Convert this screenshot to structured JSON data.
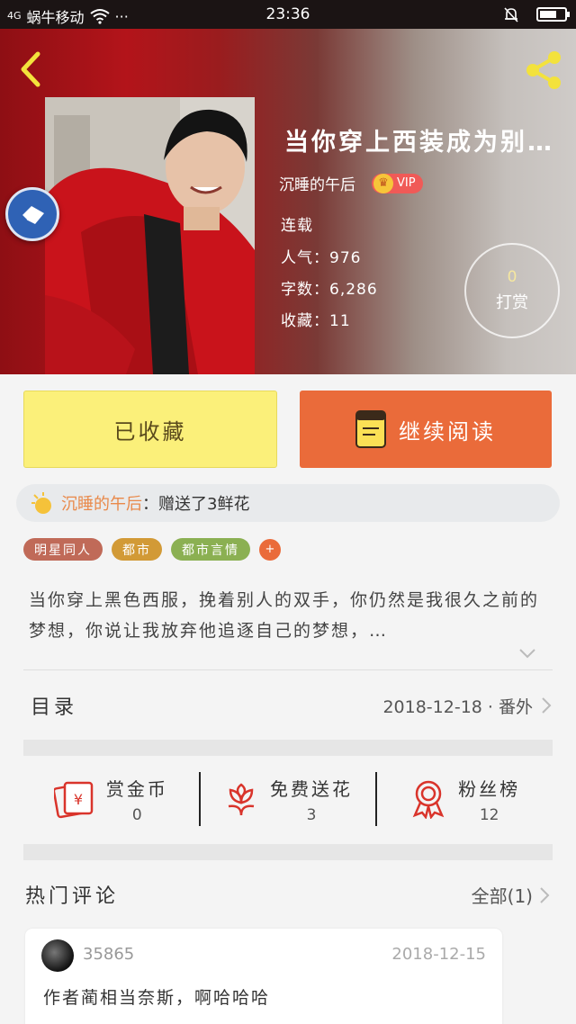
{
  "status_bar": {
    "network": "4G",
    "carrier": "蜗牛移动",
    "more": "···",
    "time": "23:36",
    "battery_level": 0.7
  },
  "book": {
    "title": "当你穿上西装成为别…",
    "author": "沉睡的午后",
    "vip_label": "VIP",
    "status": "连载",
    "popularity_label": "人气：976",
    "word_count_label": "字数：6,286",
    "favorites_label": "收藏：11"
  },
  "tip": {
    "count": "0",
    "label": "打赏"
  },
  "actions": {
    "collected_label": "已收藏",
    "continue_label": "继续阅读"
  },
  "gift": {
    "user": "沉睡的午后",
    "text": "：赠送了3鲜花"
  },
  "tags": [
    {
      "label": "明星同人",
      "color": "#c06a58"
    },
    {
      "label": "都市",
      "color": "#d29a36"
    },
    {
      "label": "都市言情",
      "color": "#8bb052"
    }
  ],
  "tag_more": "+",
  "description": "当你穿上黑色西服，挽着别人的双手，你仍然是我很久之前的梦想，你说让我放弃他追逐自己的梦想，…",
  "toc": {
    "label": "目录",
    "latest": "2018-12-18 · 番外"
  },
  "stats": [
    {
      "label": "赏金币",
      "value": "0",
      "icon": "red-envelope-icon"
    },
    {
      "label": "免费送花",
      "value": "3",
      "icon": "flower-icon"
    },
    {
      "label": "粉丝榜",
      "value": "12",
      "icon": "medal-icon"
    }
  ],
  "hot_comments": {
    "title": "热门评论",
    "all_label": "全部(1)",
    "items": [
      {
        "user": "35865",
        "date": "2018-12-15",
        "text": "作者蔺相当奈斯，啊哈哈哈"
      }
    ]
  },
  "colors": {
    "accent": "#ea6b3a",
    "collect": "#fbf07a",
    "stat_icon": "#d9342b",
    "gift_user": "#e9894a"
  }
}
